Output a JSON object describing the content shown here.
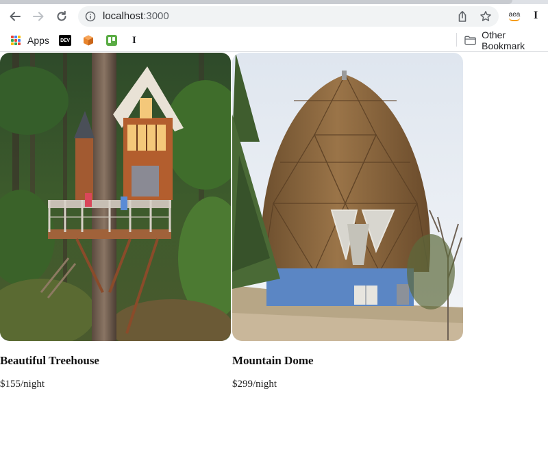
{
  "browser": {
    "url_host": "localhost",
    "url_port": ":3000",
    "extension_aea_label": "aea",
    "extension_i_label": "I"
  },
  "bookmarks": {
    "apps_label": "Apps",
    "dev_label": "DEV",
    "serif_i_label": "I",
    "other_label": "Other Bookmark"
  },
  "listings": [
    {
      "title": "Beautiful Treehouse",
      "price": "$155/night",
      "image": "treehouse-in-forest-photo"
    },
    {
      "title": "Mountain Dome",
      "price": "$299/night",
      "image": "shingled-geodesic-dome-photo"
    }
  ],
  "colors": {
    "omnibox_bg": "#f1f3f4",
    "chrome_strip": "#dee1e6",
    "trello_green": "#5aac44",
    "amazon_orange": "#f59c1a"
  }
}
